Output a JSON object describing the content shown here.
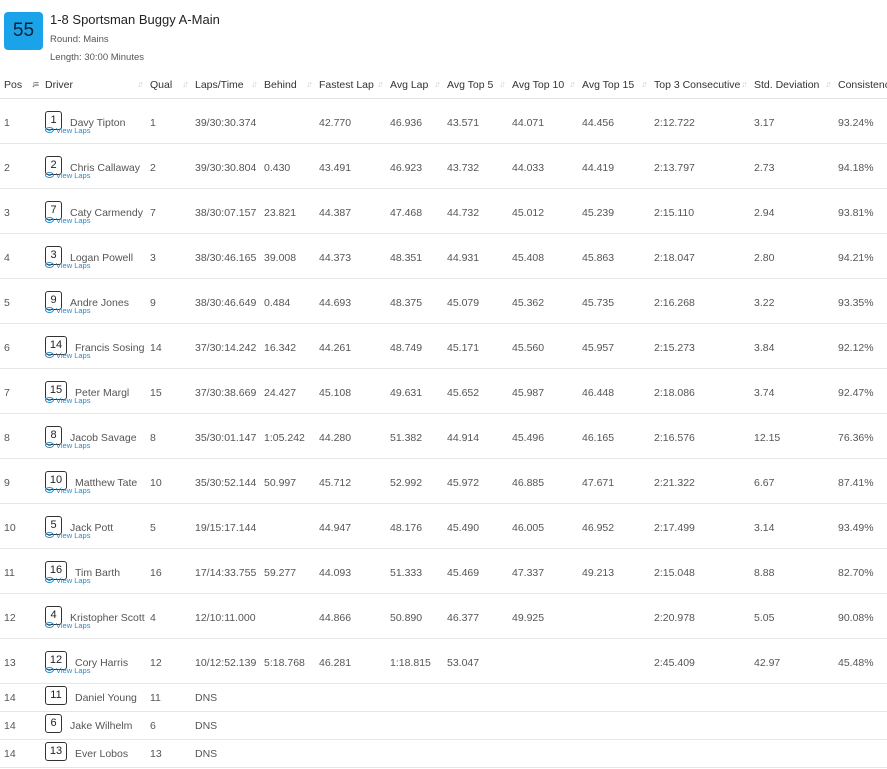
{
  "race": {
    "number": "55",
    "title": "1-8 Sportsman Buggy A-Main",
    "round": "Round: Mains",
    "length": "Length: 30:00 Minutes"
  },
  "columns": [
    "Pos",
    "Driver",
    "Qual",
    "Laps/Time",
    "Behind",
    "Fastest Lap",
    "Avg Lap",
    "Avg Top 5",
    "Avg Top 10",
    "Avg Top 15",
    "Top 3 Consecutive",
    "Std. Deviation",
    "Consistency"
  ],
  "view_laps_label": "View Laps",
  "rows": [
    {
      "pos": "1",
      "car": "1",
      "driver": "Davy Tipton",
      "qual": "1",
      "laps": "39/30:30.374",
      "behind": "",
      "fastest": "42.770",
      "avg": "46.936",
      "top5": "43.571",
      "top10": "44.071",
      "top15": "44.456",
      "top3c": "2:12.722",
      "std": "3.17",
      "cons": "93.24%"
    },
    {
      "pos": "2",
      "car": "2",
      "driver": "Chris Callaway",
      "qual": "2",
      "laps": "39/30:30.804",
      "behind": "0.430",
      "fastest": "43.491",
      "avg": "46.923",
      "top5": "43.732",
      "top10": "44.033",
      "top15": "44.419",
      "top3c": "2:13.797",
      "std": "2.73",
      "cons": "94.18%"
    },
    {
      "pos": "3",
      "car": "7",
      "driver": "Caty Carmendy",
      "qual": "7",
      "laps": "38/30:07.157",
      "behind": "23.821",
      "fastest": "44.387",
      "avg": "47.468",
      "top5": "44.732",
      "top10": "45.012",
      "top15": "45.239",
      "top3c": "2:15.110",
      "std": "2.94",
      "cons": "93.81%"
    },
    {
      "pos": "4",
      "car": "3",
      "driver": "Logan Powell",
      "qual": "3",
      "laps": "38/30:46.165",
      "behind": "39.008",
      "fastest": "44.373",
      "avg": "48.351",
      "top5": "44.931",
      "top10": "45.408",
      "top15": "45.863",
      "top3c": "2:18.047",
      "std": "2.80",
      "cons": "94.21%"
    },
    {
      "pos": "5",
      "car": "9",
      "driver": "Andre Jones",
      "qual": "9",
      "laps": "38/30:46.649",
      "behind": "0.484",
      "fastest": "44.693",
      "avg": "48.375",
      "top5": "45.079",
      "top10": "45.362",
      "top15": "45.735",
      "top3c": "2:16.268",
      "std": "3.22",
      "cons": "93.35%"
    },
    {
      "pos": "6",
      "car": "14",
      "driver": "Francis Sosing",
      "qual": "14",
      "laps": "37/30:14.242",
      "behind": "16.342",
      "fastest": "44.261",
      "avg": "48.749",
      "top5": "45.171",
      "top10": "45.560",
      "top15": "45.957",
      "top3c": "2:15.273",
      "std": "3.84",
      "cons": "92.12%"
    },
    {
      "pos": "7",
      "car": "15",
      "driver": "Peter Margl",
      "qual": "15",
      "laps": "37/30:38.669",
      "behind": "24.427",
      "fastest": "45.108",
      "avg": "49.631",
      "top5": "45.652",
      "top10": "45.987",
      "top15": "46.448",
      "top3c": "2:18.086",
      "std": "3.74",
      "cons": "92.47%"
    },
    {
      "pos": "8",
      "car": "8",
      "driver": "Jacob Savage",
      "qual": "8",
      "laps": "35/30:01.147",
      "behind": "1:05.242",
      "fastest": "44.280",
      "avg": "51.382",
      "top5": "44.914",
      "top10": "45.496",
      "top15": "46.165",
      "top3c": "2:16.576",
      "std": "12.15",
      "cons": "76.36%"
    },
    {
      "pos": "9",
      "car": "10",
      "driver": "Matthew Tate",
      "qual": "10",
      "laps": "35/30:52.144",
      "behind": "50.997",
      "fastest": "45.712",
      "avg": "52.992",
      "top5": "45.972",
      "top10": "46.885",
      "top15": "47.671",
      "top3c": "2:21.322",
      "std": "6.67",
      "cons": "87.41%"
    },
    {
      "pos": "10",
      "car": "5",
      "driver": "Jack Pott",
      "qual": "5",
      "laps": "19/15:17.144",
      "behind": "",
      "fastest": "44.947",
      "avg": "48.176",
      "top5": "45.490",
      "top10": "46.005",
      "top15": "46.952",
      "top3c": "2:17.499",
      "std": "3.14",
      "cons": "93.49%"
    },
    {
      "pos": "11",
      "car": "16",
      "driver": "Tim Barth",
      "qual": "16",
      "laps": "17/14:33.755",
      "behind": "59.277",
      "fastest": "44.093",
      "avg": "51.333",
      "top5": "45.469",
      "top10": "47.337",
      "top15": "49.213",
      "top3c": "2:15.048",
      "std": "8.88",
      "cons": "82.70%"
    },
    {
      "pos": "12",
      "car": "4",
      "driver": "Kristopher Scott",
      "qual": "4",
      "laps": "12/10:11.000",
      "behind": "",
      "fastest": "44.866",
      "avg": "50.890",
      "top5": "46.377",
      "top10": "49.925",
      "top15": "",
      "top3c": "2:20.978",
      "std": "5.05",
      "cons": "90.08%"
    },
    {
      "pos": "13",
      "car": "12",
      "driver": "Cory Harris",
      "qual": "12",
      "laps": "10/12:52.139",
      "behind": "5:18.768",
      "fastest": "46.281",
      "avg": "1:18.815",
      "top5": "53.047",
      "top10": "",
      "top15": "",
      "top3c": "2:45.409",
      "std": "42.97",
      "cons": "45.48%"
    }
  ],
  "dns_rows": [
    {
      "pos": "14",
      "car": "11",
      "driver": "Daniel Young",
      "qual": "11",
      "laps": "DNS"
    },
    {
      "pos": "14",
      "car": "6",
      "driver": "Jake Wilhelm",
      "qual": "6",
      "laps": "DNS"
    },
    {
      "pos": "14",
      "car": "13",
      "driver": "Ever Lobos",
      "qual": "13",
      "laps": "DNS"
    }
  ]
}
